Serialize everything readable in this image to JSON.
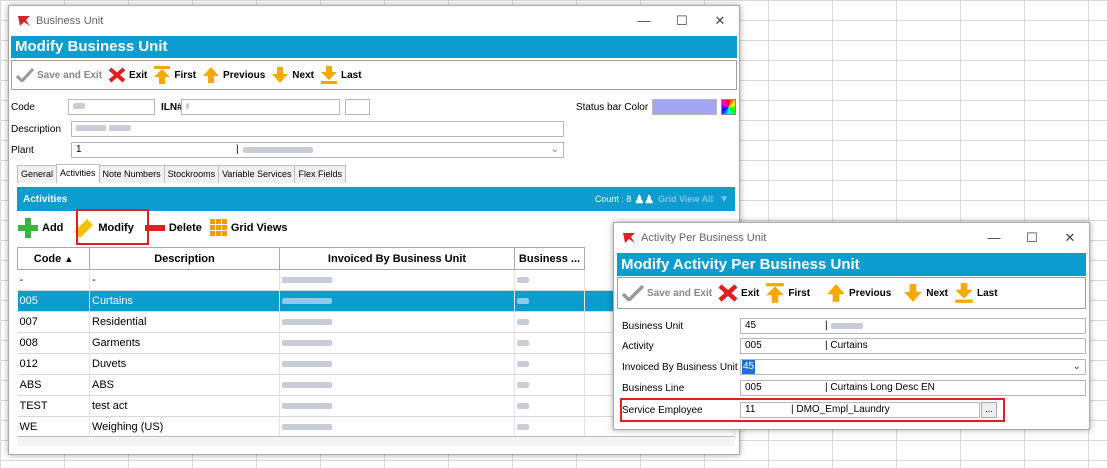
{
  "main_window": {
    "title": "Business Unit",
    "header": "Modify Business Unit",
    "toolbar": {
      "save": "Save and Exit",
      "exit": "Exit",
      "first": "First",
      "previous": "Previous",
      "next": "Next",
      "last": "Last"
    },
    "form": {
      "code_label": "Code",
      "iln_label": "ILN#",
      "status_bar_color_label": "Status bar Color",
      "status_bar_color": "#a5a5f5",
      "description_label": "Description",
      "plant_label": "Plant",
      "plant_value": "1",
      "plant_separator": "|"
    },
    "tabs": [
      "General",
      "Activities",
      "Note Numbers",
      "Stockrooms",
      "Variable Services",
      "Flex Fields"
    ],
    "activities": {
      "title": "Activities",
      "count": "Count : 8",
      "grid_view_all": "Grid View All",
      "add": "Add",
      "modify": "Modify",
      "delete": "Delete",
      "grid_views": "Grid Views",
      "columns": [
        "Code",
        "Description",
        "Invoiced By Business Unit",
        "Business ..."
      ],
      "rows": [
        {
          "code": "-",
          "description": "-"
        },
        {
          "code": "005",
          "description": "Curtains"
        },
        {
          "code": "007",
          "description": "Residential"
        },
        {
          "code": "008",
          "description": "Garments"
        },
        {
          "code": "012",
          "description": "Duvets"
        },
        {
          "code": "ABS",
          "description": "ABS"
        },
        {
          "code": "TEST",
          "description": "test act"
        },
        {
          "code": "WE",
          "description": "Weighing (US)"
        }
      ],
      "selected_row": 1
    }
  },
  "dialog": {
    "title": "Activity Per Business Unit",
    "header": "Modify Activity Per Business Unit",
    "toolbar": {
      "save": "Save and Exit",
      "exit": "Exit",
      "first": "First",
      "previous": "Previous",
      "next": "Next",
      "last": "Last"
    },
    "fields": {
      "business_unit_label": "Business Unit",
      "business_unit_code": "45",
      "business_unit_sep": "|",
      "activity_label": "Activity",
      "activity_code": "005",
      "activity_name": "| Curtains",
      "invoiced_label": "Invoiced By Business Unit",
      "invoiced_value": "45",
      "business_line_label": "Business Line",
      "business_line_code": "005",
      "business_line_name": "| Curtains Long Desc EN",
      "service_employee_label": "Service Employee",
      "service_employee_code": "11",
      "service_employee_name": "| DMO_Empl_Laundry",
      "browse_label": "..."
    }
  },
  "colors": {
    "accent": "#0c9ccf",
    "highlight": "#e02020",
    "selection": "#0c9ccf"
  }
}
